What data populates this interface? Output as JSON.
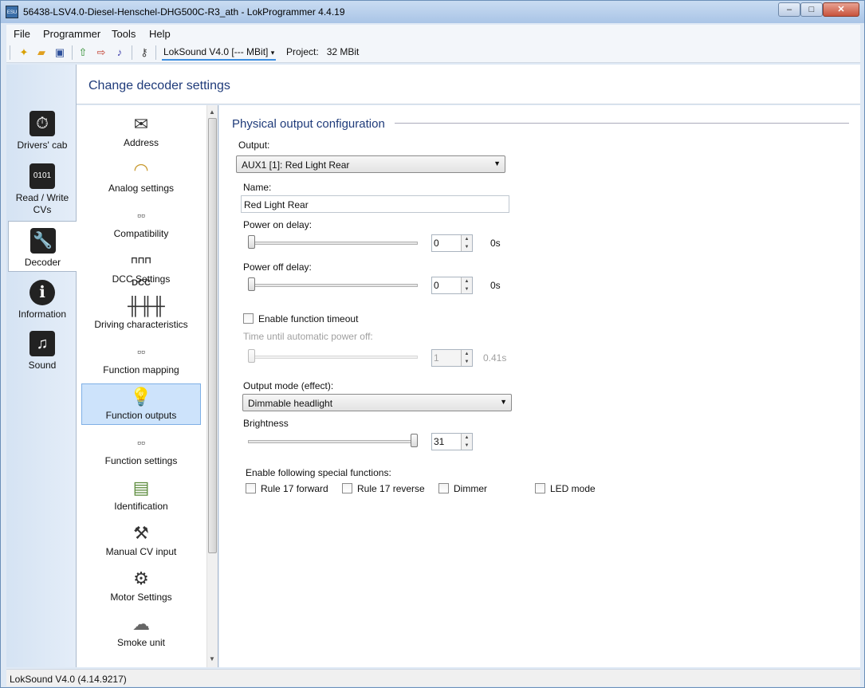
{
  "window": {
    "title": "56438-LSV4.0-Diesel-Henschel-DHG500C-R3_ath - LokProgrammer 4.4.19",
    "app_icon": "ESU"
  },
  "menu": [
    "File",
    "Programmer",
    "Tools",
    "Help"
  ],
  "toolbar": {
    "decoder": "LokSound V4.0 [--- MBit]",
    "project_label": "Project:",
    "project_value": "32 MBit"
  },
  "leftnav": [
    {
      "label": "Drivers' cab",
      "icon": "stopwatch-icon"
    },
    {
      "label": "Read / Write CVs",
      "icon": "binary-icon"
    },
    {
      "label": "Decoder",
      "icon": "wrench-icon"
    },
    {
      "label": "Information",
      "icon": "info-icon"
    },
    {
      "label": "Sound",
      "icon": "music-icon"
    }
  ],
  "header": "Change decoder settings",
  "sublist": [
    {
      "label": "Address",
      "icon": "envelope-icon"
    },
    {
      "label": "Analog settings",
      "icon": "gauge-icon"
    },
    {
      "label": "Compatibility",
      "icon": "switch-hand-icon"
    },
    {
      "label": "DCC Settings",
      "icon": "dcc-icon"
    },
    {
      "label": "Driving characteristics",
      "icon": "sliders-icon"
    },
    {
      "label": "Function mapping",
      "icon": "switch-hand-icon"
    },
    {
      "label": "Function outputs",
      "icon": "lightbulb-icon"
    },
    {
      "label": "Function settings",
      "icon": "switch-hand-icon"
    },
    {
      "label": "Identification",
      "icon": "id-card-icon"
    },
    {
      "label": "Manual CV input",
      "icon": "wrench-icon"
    },
    {
      "label": "Motor Settings",
      "icon": "motor-icon"
    },
    {
      "label": "Smoke unit",
      "icon": "smoke-icon"
    }
  ],
  "form": {
    "group_title": "Physical output configuration",
    "output_label": "Output:",
    "output_value": "AUX1 [1]: Red Light Rear",
    "name_label": "Name:",
    "name_value": "Red Light Rear",
    "power_on_label": "Power on delay:",
    "power_on_value": "0",
    "power_on_unit": "0s",
    "power_off_label": "Power off delay:",
    "power_off_value": "0",
    "power_off_unit": "0s",
    "timeout_label": "Enable function timeout",
    "auto_off_label": "Time until automatic power off:",
    "auto_off_value": "1",
    "auto_off_unit": "0.41s",
    "mode_label": "Output mode (effect):",
    "mode_value": "Dimmable headlight",
    "brightness_label": "Brightness",
    "brightness_value": "31",
    "brightness_level": 1.0,
    "special_label": "Enable following special functions:",
    "special": [
      "Rule 17 forward",
      "Rule 17 reverse",
      "Dimmer",
      "LED mode"
    ]
  },
  "status": "LokSound V4.0 (4.14.9217)"
}
